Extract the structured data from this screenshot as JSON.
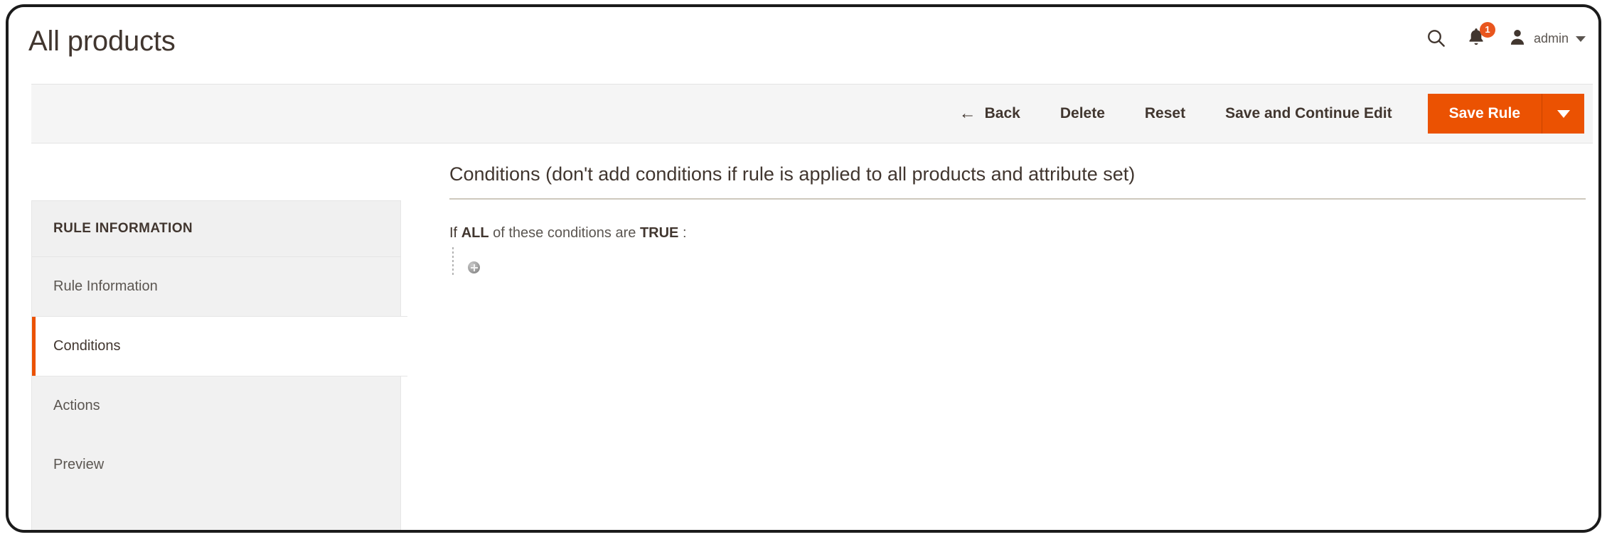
{
  "header": {
    "title": "All products",
    "search_icon": "search-icon",
    "notifications": {
      "icon": "bell-icon",
      "badge_count": "1"
    },
    "user": {
      "avatar_icon": "user-avatar-icon",
      "label": "admin",
      "caret_icon": "chevron-down-icon"
    }
  },
  "toolbar": {
    "back_arrow": "←",
    "back_label": "Back",
    "delete_label": "Delete",
    "reset_label": "Reset",
    "save_continue_label": "Save and Continue Edit",
    "save_rule_label": "Save Rule",
    "save_rule_caret_icon": "caret-down-icon"
  },
  "sidebar": {
    "header": "RULE INFORMATION",
    "items": [
      {
        "label": "Rule Information",
        "active": false
      },
      {
        "label": "Conditions",
        "active": true
      },
      {
        "label": "Actions",
        "active": false
      },
      {
        "label": "Preview",
        "active": false
      }
    ]
  },
  "main": {
    "heading": "Conditions (don't add conditions if rule is applied to all products and attribute set)",
    "condition": {
      "prefix": "If",
      "aggregator": "ALL",
      "middle": "of these conditions are",
      "value": "TRUE",
      "suffix": ":",
      "add_button_icon": "plus-circle-icon"
    }
  },
  "colors": {
    "accent_orange": "#eb5202",
    "badge_orange": "#e9561e",
    "text_dark": "#41362f",
    "text_muted": "#5b5651",
    "toolbar_bg": "#f5f5f5",
    "sidebar_bg": "#f1f1f1",
    "rule_line": "#cec8bd"
  }
}
